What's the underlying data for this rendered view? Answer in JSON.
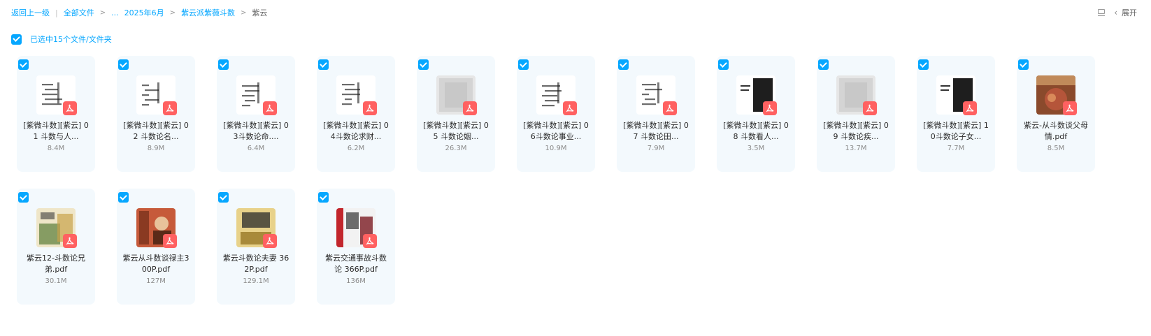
{
  "breadcrumb": {
    "back": "返回上一级",
    "all_files": "全部文件",
    "ellipsis": "...",
    "folder1": "2025年6月",
    "folder2": "紫云派紫薇斗数",
    "current": "紫云"
  },
  "toolbar": {
    "expand": "展开",
    "list_icon": "list-view-icon",
    "chevron_icon": "chevron-left-icon"
  },
  "selection": {
    "text": "已选中15个文件/文件夹"
  },
  "colors": {
    "accent": "#06a7ff",
    "card_bg": "#f3f9fd",
    "pdf_badge": "#ff6161"
  },
  "files": [
    {
      "name": "[紫微斗数][紫云] 01 斗数与人...",
      "size": "8.4M",
      "thumb": "text"
    },
    {
      "name": "[紫微斗数][紫云] 02 斗数论名...",
      "size": "8.9M",
      "thumb": "text"
    },
    {
      "name": "[紫微斗数][紫云] 03斗数论命....",
      "size": "6.4M",
      "thumb": "text"
    },
    {
      "name": "[紫微斗数][紫云] 04斗数论求财...",
      "size": "6.2M",
      "thumb": "text"
    },
    {
      "name": "[紫微斗数][紫云] 05 斗数论姻...",
      "size": "26.3M",
      "thumb": "gray"
    },
    {
      "name": "[紫微斗数][紫云] 06斗数论事业...",
      "size": "10.9M",
      "thumb": "text"
    },
    {
      "name": "[紫微斗数][紫云] 07 斗数论田...",
      "size": "7.9M",
      "thumb": "text"
    },
    {
      "name": "[紫微斗数][紫云] 08 斗数看人...",
      "size": "3.5M",
      "thumb": "dark"
    },
    {
      "name": "[紫微斗数][紫云] 09 斗数论疾...",
      "size": "13.7M",
      "thumb": "gray"
    },
    {
      "name": "[紫微斗数][紫云] 10斗数论子女...",
      "size": "7.7M",
      "thumb": "dark"
    },
    {
      "name": "紫云-从斗数谈父母情.pdf",
      "size": "8.5M",
      "thumb": "brown"
    },
    {
      "name": "紫云12-斗数论兄弟.pdf",
      "size": "30.1M",
      "thumb": "art"
    },
    {
      "name": "紫云从斗数谈禄主300P.pdf",
      "size": "127M",
      "thumb": "portrait"
    },
    {
      "name": "紫云斗数论夫妻 362P.pdf",
      "size": "129.1M",
      "thumb": "cover"
    },
    {
      "name": "紫云交通事故斗数论 366P.pdf",
      "size": "136M",
      "thumb": "red"
    }
  ]
}
